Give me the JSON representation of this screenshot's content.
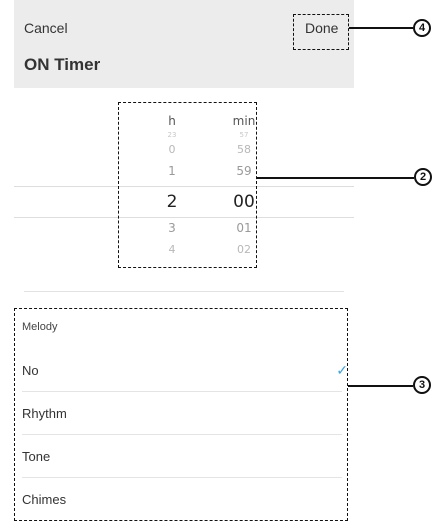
{
  "header": {
    "cancel_label": "Cancel",
    "done_label": "Done",
    "title": "ON Timer"
  },
  "picker": {
    "hour_unit": "h",
    "minute_unit": "min",
    "hours": [
      "23",
      "0",
      "1",
      "2",
      "3",
      "4"
    ],
    "minutes": [
      "57",
      "58",
      "59",
      "00",
      "01",
      "02"
    ],
    "selected_hour": "2",
    "selected_minute": "00"
  },
  "melody": {
    "header": "Melody",
    "options": [
      {
        "label": "No",
        "selected": true
      },
      {
        "label": "Rhythm",
        "selected": false
      },
      {
        "label": "Tone",
        "selected": false
      },
      {
        "label": "Chimes",
        "selected": false
      }
    ],
    "check_icon": "check-icon"
  },
  "callouts": {
    "c2": "2",
    "c3": "3",
    "c4": "4"
  },
  "colors": {
    "header_bg": "#ececec",
    "accent": "#3ba4e0"
  }
}
